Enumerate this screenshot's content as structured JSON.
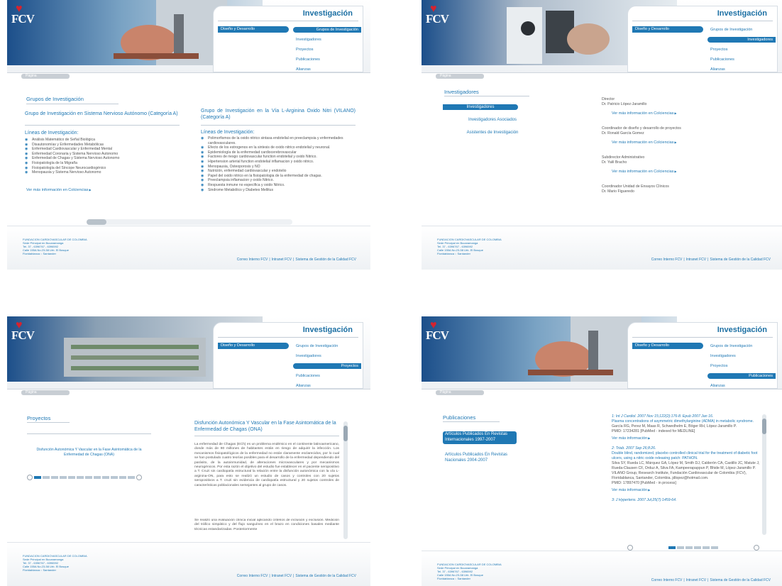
{
  "common": {
    "logo": "FCV",
    "menu_title": "Investigación",
    "left_item": "Diseño y Desarrollo",
    "right_items": [
      "Grupos de Investigación",
      "Investigadores",
      "Proyectos",
      "Publicaciones",
      "Alianzas"
    ],
    "back": "Página",
    "footer_addr": [
      "FUNDACION CARDIOVASCULAR DE COLOMBIA",
      "Sede Principal en Bucaramanga",
      "Tel. 37 - 6396767 - 6396592",
      "Calle 155A No.23-58 Urb. El Bosque",
      "Floridablanca :: Santander"
    ],
    "footer_links": [
      "Correo Interno FCV",
      "Intranet FCV",
      "Sistema de Gestión de la Calidad FCV"
    ]
  },
  "p1": {
    "section": "Grupos de Investigación",
    "group1_title": "Grupo de Investigación en Sistema Nervioso Autónomo (Categoría A)",
    "group2_title": "Grupo de Investigación en la Vía L-Arginina Oxido Nitri (VILANO) (Categoría A)",
    "lines_label": "Líneas de Investigación:",
    "lines1": [
      "Análisis Matemático de Señal Biológica",
      "Disautonomías y Enfermedades Metabólicas",
      "Enfermedad Cardiovascular y Enfermedad Mental",
      "Enfermedad Coronaria y Sistema Nervioso Autonomo",
      "Enfermedad de Chagas y Sistema Nervioso Autonomo",
      "Fisiopatología de la Migraña",
      "Fisiopatología del Síncope Neurocardiogénico",
      "Menopausia y Sistema Nervioso Autonomo"
    ],
    "lines2": [
      "Polimorfismos de la oxido nitrico sintasa endotelial en preeclampsia y enfermedades cardiovasculares.",
      "Efecto de los estrogenos en la sintesis de oxido nitrico endotelial y neuronal.",
      "Epidemiología de la enfermedad cardiocerebrovascular",
      "Factores de riesgo cardiovascular function endotelial y oxido Nitrico.",
      "Hipertension arterial function endotelial inflamacion y oxido nitrico.",
      "Menopausia, Osteoporosis y NO",
      "Nutrición, enfermedad cardiovascular y endotelio",
      "Papel del oxido nitrico en la fisiopatologia de la enfermedad de chagas.",
      "Preeclampsia inflamacion y oxido Nitrico.",
      "Respuesta inmune no especifica y oxido Nitrico.",
      "Sindrome Metabólico y Diabetes Mellitus"
    ],
    "more": "Ver más información en Colciencias"
  },
  "p2": {
    "section": "Investigadores",
    "nav": [
      "Investigadores",
      "Investigadores Asociados",
      "Asistentes de Investigación"
    ],
    "people": [
      {
        "role": "Director",
        "name": "Dr. Patricio López-Jaramillo"
      },
      {
        "role": "Coordinador de diseño y desarrollo de proyectos",
        "name": "Dr. Ronald García Gomez"
      },
      {
        "role": "Subdirector Administrativo",
        "name": "Dr. Yalil Bracho"
      },
      {
        "role": "Coordinador Unidad de Ensayos Clínicos",
        "name": "Dr. Mario Figueredo"
      }
    ],
    "more": "Ver más información en Colciencias"
  },
  "p3": {
    "section": "Proyectos",
    "project_link": "Disfunción Autonómica Y Vascular en la Fase Asintomática de la Enfermedad de Chagas (ONA)",
    "title": "Disfunción Autonómica Y Vascular en la Fase Asintomática de la Enfermedad de Chagas (ONA)",
    "para1": "La enfermedad de Chagas (ECh) es un problema endémico en el continente latinoamericano, donde más de 90 millones de habitantes están en riesgo de adquirir la infección. Los mecanismos fisiopatológicos de la enfermedad no están claramente esclarecidos, por lo cual se han postulado cuatro teorías posibles para el desarrollo de la enfermedad dependiendo del parásito, de la autoinmunidad, de alteraciones microvasculares y por mecanismos neurogénicos. Por esta razón el objetivo del estudio fue establecer en el paciente seropositivo a T. Cruzi sin cardiopatía estructural la relación entre la disfunción autonómica con la vía L- arginina-ON, para esto se realizó un estudio de casos y controles con 20 sujetos seropositivos a T. cruzi sin evidencia de cardiopatía estructural y 20 sujetos controles de características poblacionales semejantes al grupo de casos.",
    "para2": "Se realizó una evaluación clínica inicial aplicando criterios de inclusión y exclusión. Medición del tráfico simpático y del flujo sanguíneo en el brazo en condiciones basales mediante técnicas estandarizadas. Posteriormente"
  },
  "p4": {
    "section": "Publicaciones",
    "nav": [
      "Artículos Publicados En Revistas Internacionales 1997-2007",
      "Artículos Publicados En Revistas Nacionales 2004-2007"
    ],
    "pubs": [
      {
        "ref": "1: Int J Cardiol. 2007 Nov 15;122(2):176-8. Epub 2007 Jan 16.",
        "title": "Plasma concentrations of asymmetric dimethylarginine (ADMA) in metabolic syndrome.",
        "authors": "García RG, Perez M, Maas R, Schwedhelm E, Böger RH, López-Jaramillo P.",
        "pmid": "PMID: 17234281 [PubMed - indexed for MEDLINE]",
        "more": "Ver más información"
      },
      {
        "ref": "2: Triab. 2007 Sep 26;8:26.",
        "title": "Double blind, randomized, placebo controlled clinical trial for the treatment of diabetic foot ulcers, using a nitric oxide releasing patch: PATHON.",
        "authors": "Silva SY, Rueda LC, Márquez GA, López M, Smith DJ, Calderón CA, Castillo JC, Matute J, Rueda-Clausen CF, Orduz A, Silva FA, Kampeerapappun P, Bhide M, López-Jaramillo P.",
        "extra": "VILANO Group, Research Institute, Fundación Cardiovascular de Colombia (FCV), Floridablanca, Santander, Colombia. jdlopez@hotmail.com.",
        "pmid": "PMID: 17897470 [PubMed - in process]",
        "more": "Ver más información"
      },
      {
        "ref": "3: J Hypertens. 2007 Jul;25(7):1459-64."
      }
    ]
  }
}
